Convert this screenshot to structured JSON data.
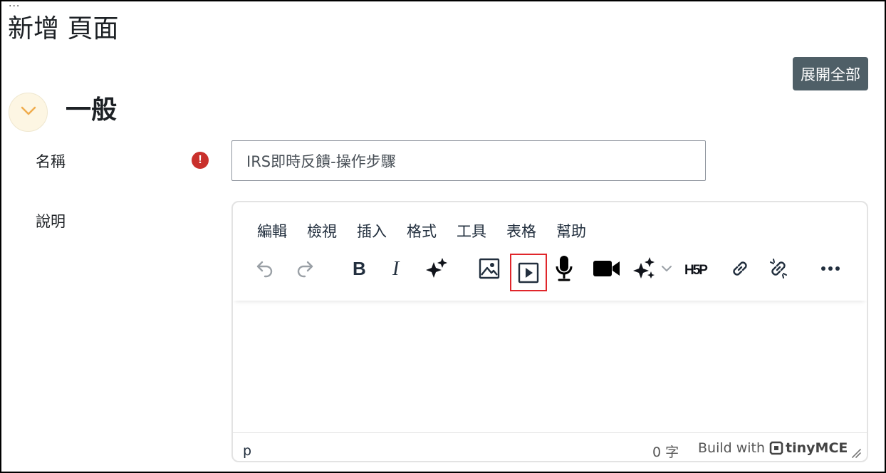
{
  "page": {
    "dots": "...",
    "title": "新增 頁面",
    "expand_all_label": "展開全部"
  },
  "section": {
    "title": "一般",
    "toggle_icon": "chevron-down-icon",
    "accent": "#f0ad4e"
  },
  "form": {
    "name_label": "名稱",
    "name_value": "IRS即時反饋-操作步驟",
    "required_icon": "exclamation-circle-icon",
    "required_color": "#c9302c",
    "description_label": "說明"
  },
  "editor": {
    "menu": [
      "編輯",
      "檢視",
      "插入",
      "格式",
      "工具",
      "表格",
      "幫助"
    ],
    "toolbar": [
      {
        "name": "undo-icon"
      },
      {
        "name": "redo-icon"
      },
      {
        "name": "bold-icon"
      },
      {
        "name": "italic-icon"
      },
      {
        "name": "ai-sparkle-icon"
      },
      {
        "name": "image-icon"
      },
      {
        "name": "media-icon",
        "highlighted": true
      },
      {
        "name": "microphone-icon"
      },
      {
        "name": "video-camera-icon"
      },
      {
        "name": "ai-sparkles-dropdown-icon"
      },
      {
        "name": "h5p-icon"
      },
      {
        "name": "link-icon"
      },
      {
        "name": "unlink-icon"
      },
      {
        "name": "more-icon"
      }
    ],
    "status_path": "p",
    "word_count": "0 字",
    "build_with": "Build with",
    "brand_name": "tinyMCE"
  }
}
